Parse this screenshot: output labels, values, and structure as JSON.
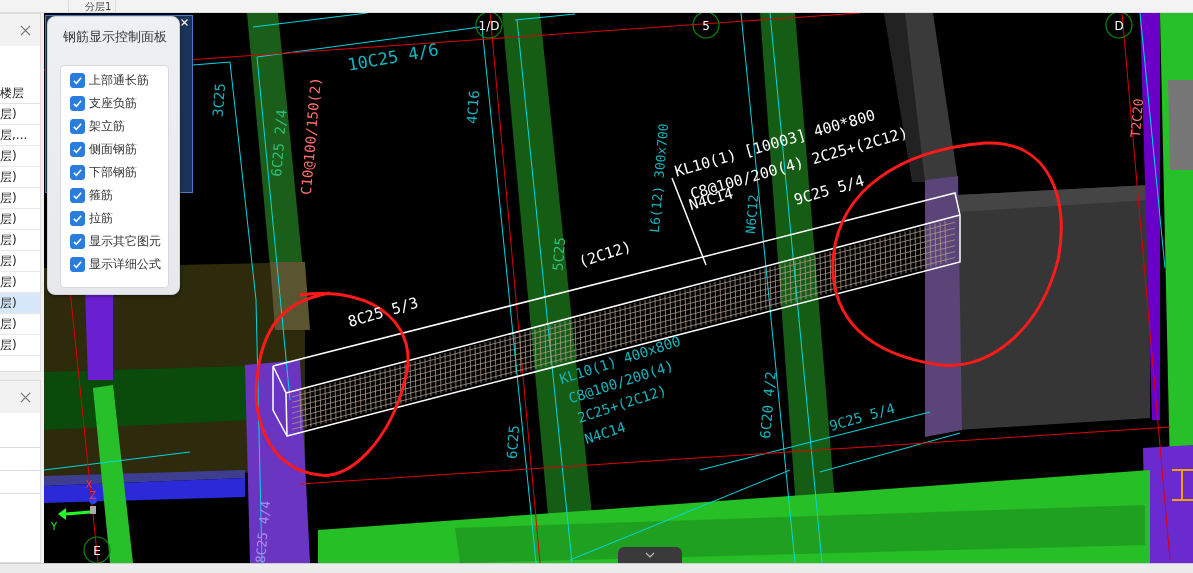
{
  "toolbar": {
    "label": "分层1"
  },
  "floor_panel": {
    "header": "楼层",
    "rows": [
      {
        "label": "层)",
        "selected": false
      },
      {
        "label": "层,...",
        "selected": false
      },
      {
        "label": "层)",
        "selected": false
      },
      {
        "label": "层)",
        "selected": false
      },
      {
        "label": "层)",
        "selected": false
      },
      {
        "label": "层)",
        "selected": false
      },
      {
        "label": "层)",
        "selected": false
      },
      {
        "label": "层)",
        "selected": false
      },
      {
        "label": "层)",
        "selected": false
      },
      {
        "label": "层)",
        "selected": true
      },
      {
        "label": "层)",
        "selected": false
      },
      {
        "label": "层)",
        "selected": false
      }
    ]
  },
  "rebar_panel": {
    "title": "钢筋显示控制面板",
    "options": [
      {
        "label": "上部通长筋",
        "checked": true
      },
      {
        "label": "支座负筋",
        "checked": true
      },
      {
        "label": "架立筋",
        "checked": true
      },
      {
        "label": "侧面钢筋",
        "checked": true
      },
      {
        "label": "下部钢筋",
        "checked": true
      },
      {
        "label": "箍筋",
        "checked": true
      },
      {
        "label": "拉筋",
        "checked": true
      },
      {
        "label": "显示其它图元",
        "checked": true
      },
      {
        "label": "显示详细公式",
        "checked": true
      }
    ]
  },
  "viewport": {
    "axis_markers": [
      "1/D",
      "5",
      "D",
      "E"
    ],
    "gizmo_axes": [
      "X",
      "Z",
      "Y"
    ],
    "labels": [
      {
        "text": "10C25 4/6",
        "color": "#17b5c0"
      },
      {
        "text": "3C25",
        "color": "#17b5c0"
      },
      {
        "text": "6C25 2/4",
        "color": "#2fbf7f"
      },
      {
        "text": "C10@100/150(2)",
        "color": "#ff6f6f"
      },
      {
        "text": "4C16",
        "color": "#17b5c0"
      },
      {
        "text": "5C25",
        "color": "#2fbf7f"
      },
      {
        "text": "(2C12)",
        "color": "#ffffff"
      },
      {
        "text": "L6(12) 300x700",
        "color": "#17b5c0"
      },
      {
        "text": "N6C12",
        "color": "#17b5c0"
      },
      {
        "text": "KL10(1) [10003] 400*800",
        "color": "#ffffff"
      },
      {
        "text": "C8@100/200(4) 2C25+(2C12)",
        "color": "#ffffff"
      },
      {
        "text": "N4C14",
        "color": "#ffffff"
      },
      {
        "text": "9C25 5/4",
        "color": "#ffffff"
      },
      {
        "text": "8C25 5/3",
        "color": "#ffffff"
      },
      {
        "text": "KL10(1) 400x800",
        "color": "#17b5c0"
      },
      {
        "text": "C8@100/200(4)",
        "color": "#17b5c0"
      },
      {
        "text": "2C25+(2C12)",
        "color": "#17b5c0"
      },
      {
        "text": "N4C14",
        "color": "#17b5c0"
      },
      {
        "text": "6C25",
        "color": "#17b5c0"
      },
      {
        "text": "6C20 4/2",
        "color": "#17b5c0"
      },
      {
        "text": "9C25 5/4",
        "color": "#17b5c0"
      },
      {
        "text": "T2C20",
        "color": "#ff6f6f"
      },
      {
        "text": "8C25 4/4",
        "color": "#a88cf0"
      }
    ]
  }
}
